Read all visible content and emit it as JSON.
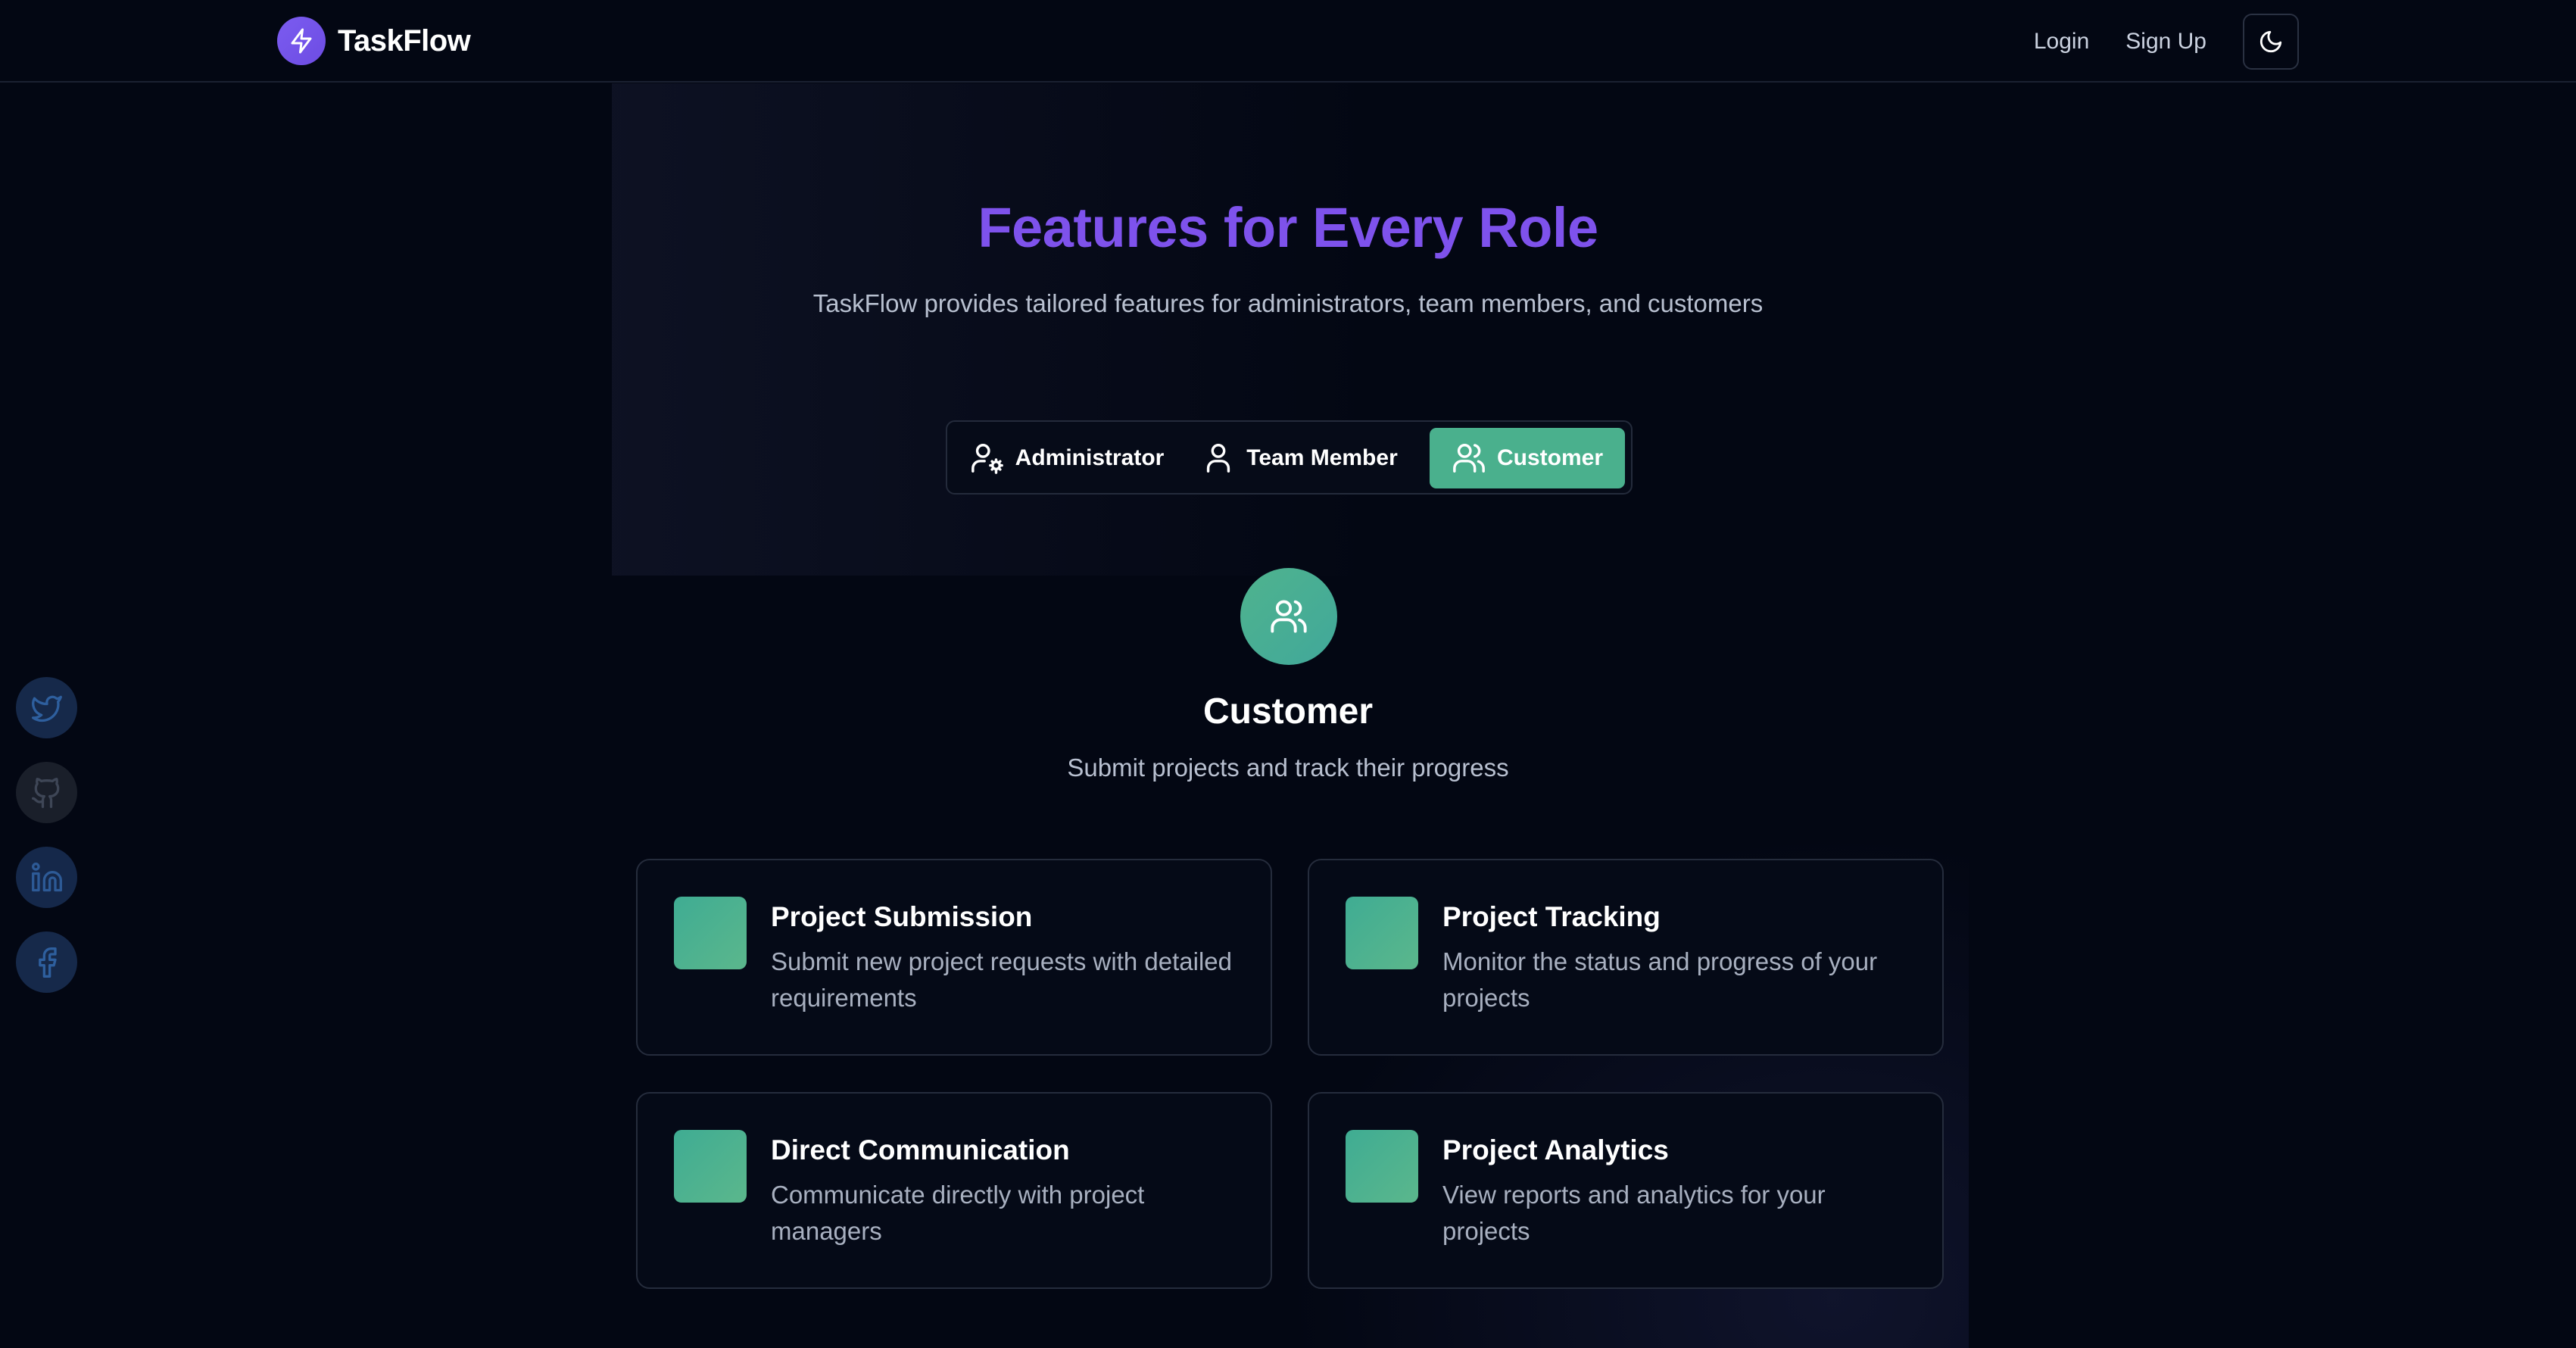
{
  "header": {
    "brand": "TaskFlow",
    "login": "Login",
    "signup": "Sign Up"
  },
  "hero": {
    "title": "Features for Every Role",
    "subtitle": "TaskFlow provides tailored features for administrators, team members, and customers"
  },
  "tabs": [
    {
      "label": "Administrator",
      "icon": "user-gear-icon",
      "active": false
    },
    {
      "label": "Team Member",
      "icon": "user-icon",
      "active": false
    },
    {
      "label": "Customer",
      "icon": "users-icon",
      "active": true
    }
  ],
  "role": {
    "title": "Customer",
    "description": "Submit projects and track their progress",
    "icon": "users-icon"
  },
  "features": [
    {
      "title": "Project Submission",
      "description": "Submit new project requests with detailed requirements"
    },
    {
      "title": "Project Tracking",
      "description": "Monitor the status and progress of your projects"
    },
    {
      "title": "Direct Communication",
      "description": "Communicate directly with project managers"
    },
    {
      "title": "Project Analytics",
      "description": "View reports and analytics for your projects"
    }
  ],
  "social": [
    {
      "name": "twitter-icon"
    },
    {
      "name": "github-icon"
    },
    {
      "name": "linkedin-icon"
    },
    {
      "name": "facebook-icon"
    }
  ],
  "colors": {
    "background": "#030713",
    "accent_purple": "#7e52ec",
    "accent_green": "#4ab08d"
  }
}
